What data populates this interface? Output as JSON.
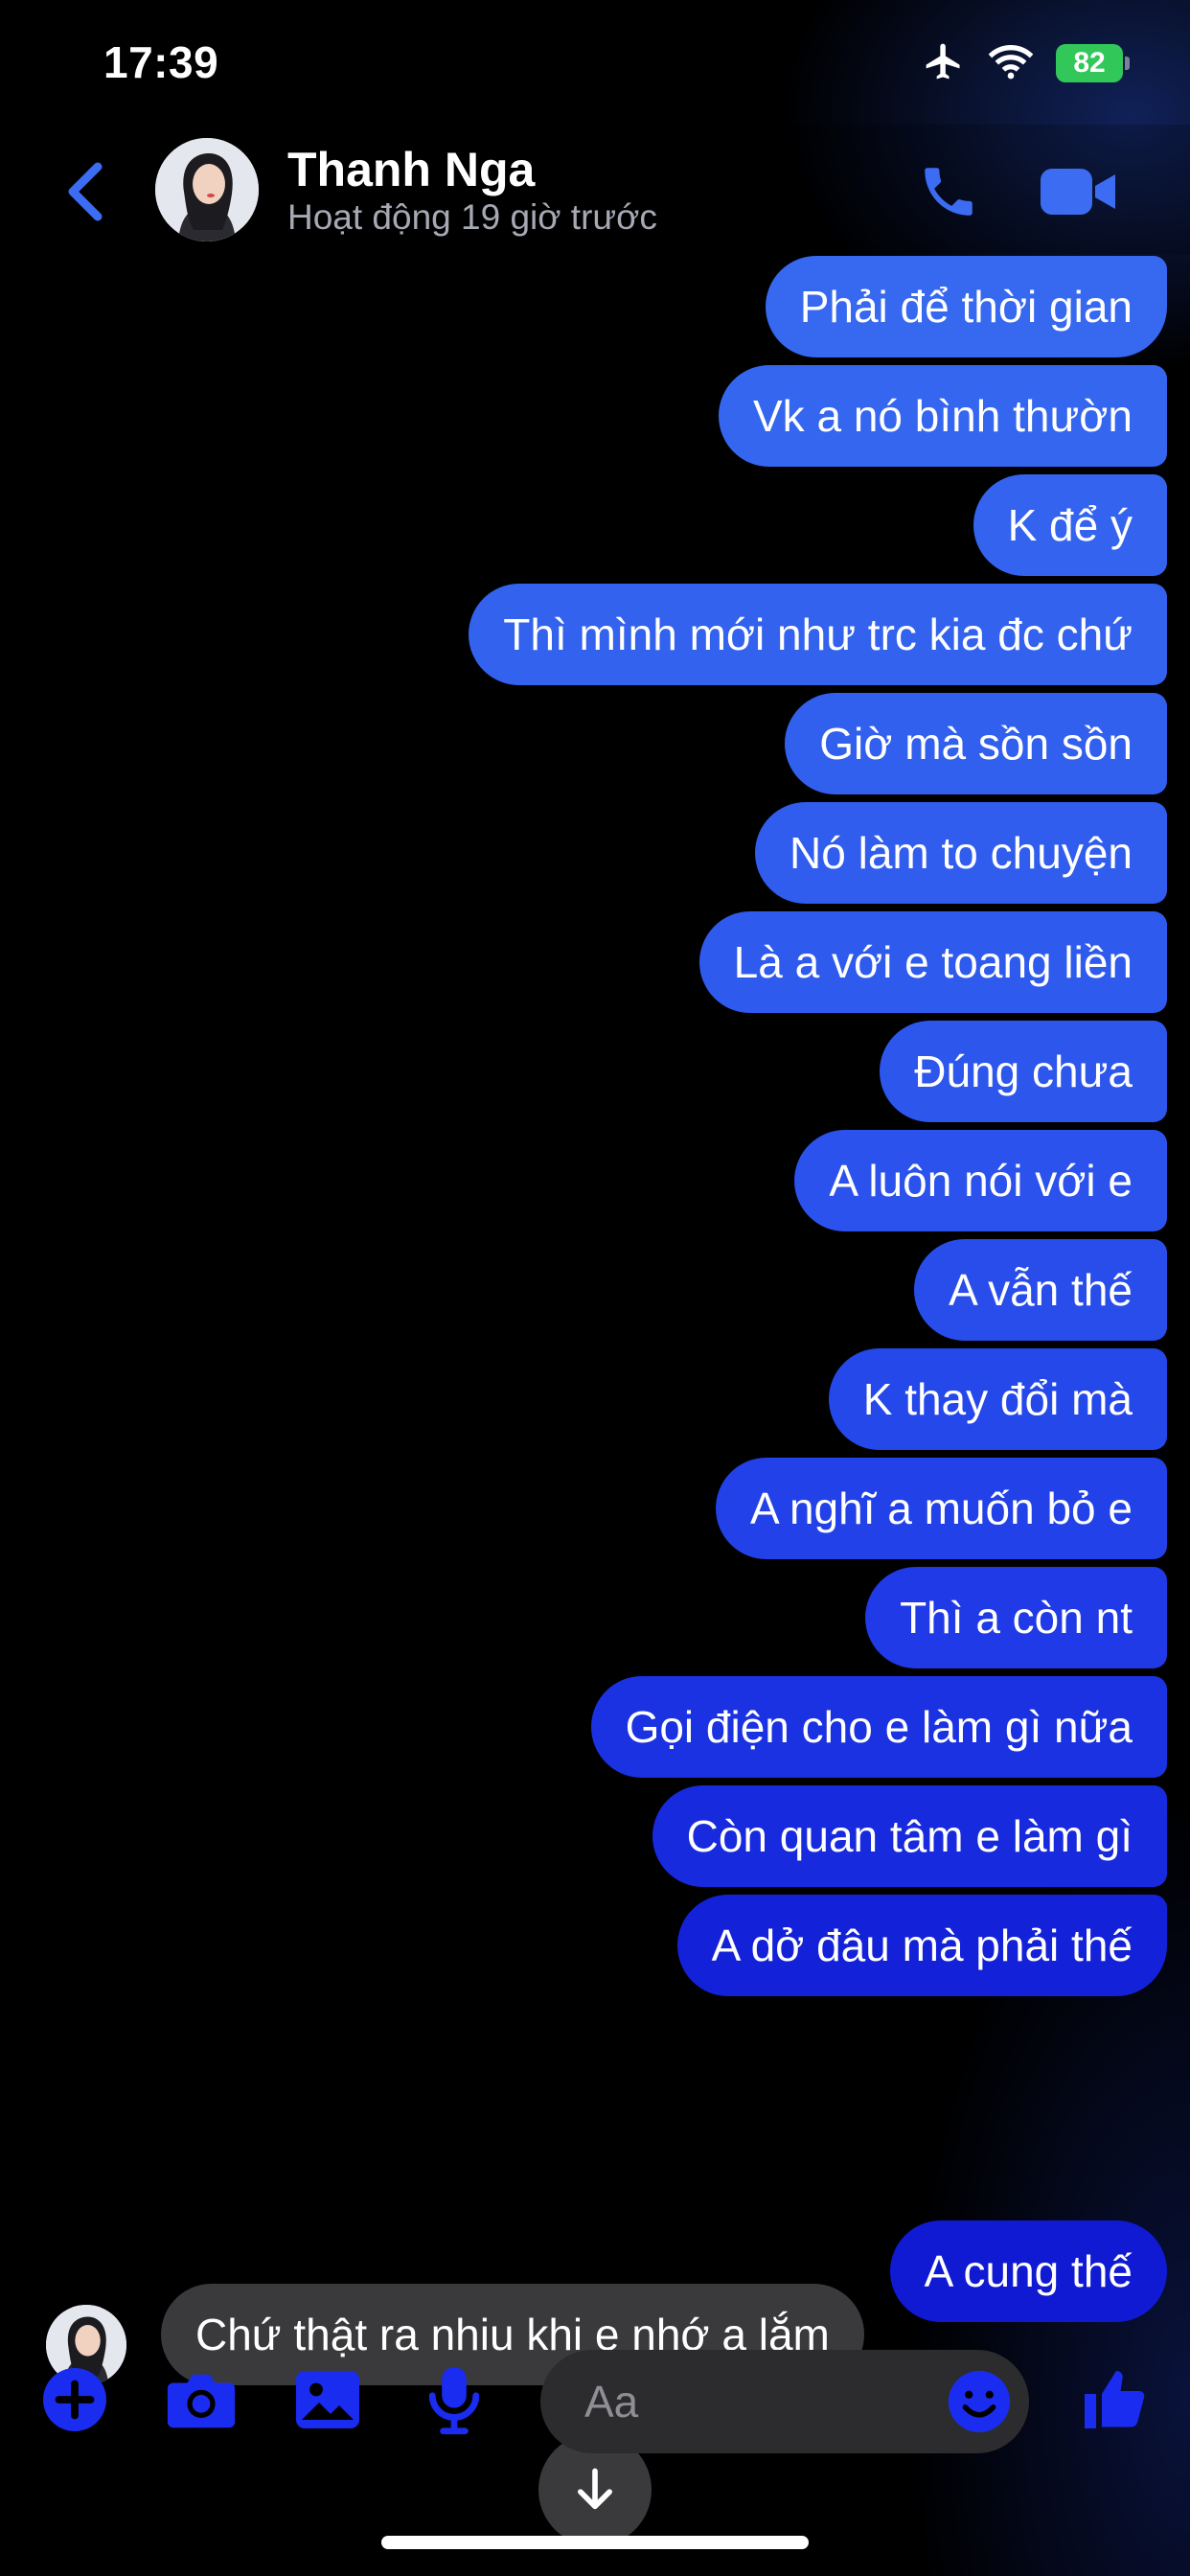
{
  "status_bar": {
    "time": "17:39",
    "battery": "82",
    "icons": [
      "airplane-icon",
      "wifi-icon",
      "battery-icon"
    ]
  },
  "header": {
    "contact_name": "Thanh Nga",
    "contact_status": "Hoạt động 19 giờ trước",
    "icons": [
      "back-chevron-icon",
      "phone-icon",
      "video-camera-icon"
    ]
  },
  "messages": {
    "outgoing": [
      {
        "text": "Phải để thời gian",
        "color": "#3668f0"
      },
      {
        "text": "Vk a nó bình thườn",
        "color": "#3566ef"
      },
      {
        "text": "K để ý",
        "color": "#3464ef"
      },
      {
        "text": "Thì mình mới như trc kia đc chứ",
        "color": "#3362ee"
      },
      {
        "text": "Giờ mà sồn sồn",
        "color": "#3260ee"
      },
      {
        "text": "Nó làm to chuyện",
        "color": "#305dee"
      },
      {
        "text": "Là a với e toang liền",
        "color": "#2f5aee"
      },
      {
        "text": "Đúng chưa",
        "color": "#2d56ed"
      },
      {
        "text": "A luôn nói với e",
        "color": "#2b52ec"
      },
      {
        "text": "A vẫn thế",
        "color": "#284deb"
      },
      {
        "text": "K thay đổi mà",
        "color": "#2548ea"
      },
      {
        "text": "A nghĩ a muốn bỏ e",
        "color": "#2241e8"
      },
      {
        "text": "Thì a còn nt",
        "color": "#1f3ae6"
      },
      {
        "text": "Gọi điện cho e làm gì nữa",
        "color": "#1b32e2"
      },
      {
        "text": "Còn quan tâm e làm gì",
        "color": "#172ade"
      },
      {
        "text": "A dở đâu mà phải thế",
        "color": "#1322d8"
      }
    ],
    "incoming": {
      "text": "Chứ thật ra nhiu khi e nhớ a lắm",
      "reaction": "❤️"
    },
    "last_outgoing": {
      "text": "A cung thế",
      "color": "#0f1ad2"
    }
  },
  "composer": {
    "placeholder": "Aa",
    "icons": [
      "plus-icon",
      "camera-icon",
      "photo-icon",
      "microphone-icon",
      "emoji-icon",
      "thumbs-up-icon"
    ],
    "accent_color": "#1a2cf0"
  },
  "colors": {
    "accent": "#3c6cf2",
    "incoming_bubble": "#3a3a3c",
    "status_gray": "#a6a9b4"
  }
}
